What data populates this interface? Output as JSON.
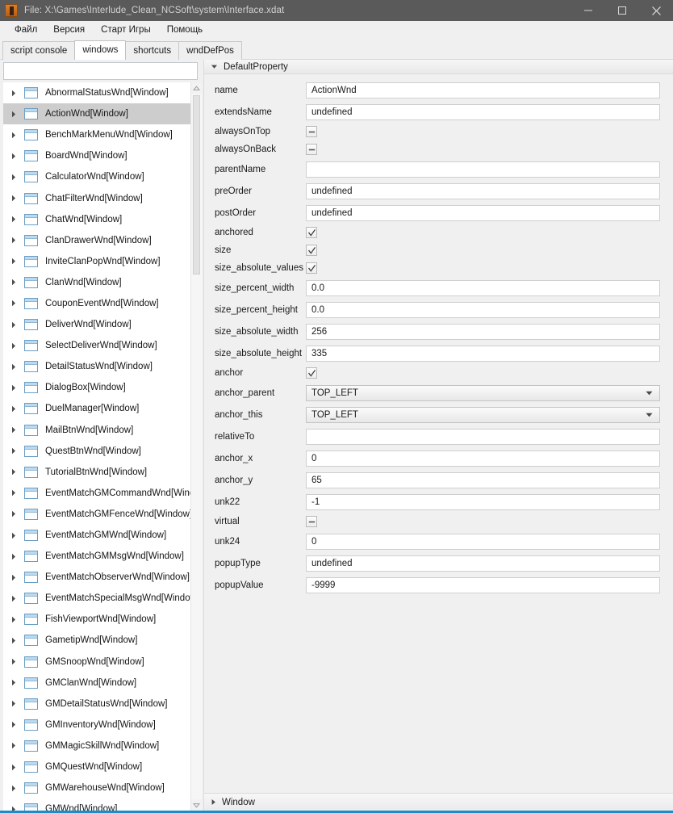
{
  "titlebar": {
    "title": "File: X:\\Games\\Interlude_Clean_NCSoft\\system\\Interface.xdat",
    "minimize_label": "—",
    "maximize_label": "☐",
    "close_label": "✕"
  },
  "menubar": {
    "items": [
      {
        "label": "Файл"
      },
      {
        "label": "Версия"
      },
      {
        "label": "Старт Игры"
      },
      {
        "label": "Помощь"
      }
    ]
  },
  "tabs": {
    "items": [
      {
        "label": "script console",
        "active": false
      },
      {
        "label": "windows",
        "active": true
      },
      {
        "label": "shortcuts",
        "active": false
      },
      {
        "label": "wndDefPos",
        "active": false
      }
    ]
  },
  "left_panel": {
    "filter": {
      "value": "",
      "placeholder": ""
    },
    "tree_items": [
      {
        "label": "AbnormalStatusWnd[Window]",
        "selected": false
      },
      {
        "label": "ActionWnd[Window]",
        "selected": true
      },
      {
        "label": "BenchMarkMenuWnd[Window]",
        "selected": false
      },
      {
        "label": "BoardWnd[Window]",
        "selected": false
      },
      {
        "label": "CalculatorWnd[Window]",
        "selected": false
      },
      {
        "label": "ChatFilterWnd[Window]",
        "selected": false
      },
      {
        "label": "ChatWnd[Window]",
        "selected": false
      },
      {
        "label": "ClanDrawerWnd[Window]",
        "selected": false
      },
      {
        "label": "InviteClanPopWnd[Window]",
        "selected": false
      },
      {
        "label": "ClanWnd[Window]",
        "selected": false
      },
      {
        "label": "CouponEventWnd[Window]",
        "selected": false
      },
      {
        "label": "DeliverWnd[Window]",
        "selected": false
      },
      {
        "label": "SelectDeliverWnd[Window]",
        "selected": false
      },
      {
        "label": "DetailStatusWnd[Window]",
        "selected": false
      },
      {
        "label": "DialogBox[Window]",
        "selected": false
      },
      {
        "label": "DuelManager[Window]",
        "selected": false
      },
      {
        "label": "MailBtnWnd[Window]",
        "selected": false
      },
      {
        "label": "QuestBtnWnd[Window]",
        "selected": false
      },
      {
        "label": "TutorialBtnWnd[Window]",
        "selected": false
      },
      {
        "label": "EventMatchGMCommandWnd[Window]",
        "selected": false
      },
      {
        "label": "EventMatchGMFenceWnd[Window]",
        "selected": false
      },
      {
        "label": "EventMatchGMWnd[Window]",
        "selected": false
      },
      {
        "label": "EventMatchGMMsgWnd[Window]",
        "selected": false
      },
      {
        "label": "EventMatchObserverWnd[Window]",
        "selected": false
      },
      {
        "label": "EventMatchSpecialMsgWnd[Window]",
        "selected": false
      },
      {
        "label": "FishViewportWnd[Window]",
        "selected": false
      },
      {
        "label": "GametipWnd[Window]",
        "selected": false
      },
      {
        "label": "GMSnoopWnd[Window]",
        "selected": false
      },
      {
        "label": "GMClanWnd[Window]",
        "selected": false
      },
      {
        "label": "GMDetailStatusWnd[Window]",
        "selected": false
      },
      {
        "label": "GMInventoryWnd[Window]",
        "selected": false
      },
      {
        "label": "GMMagicSkillWnd[Window]",
        "selected": false
      },
      {
        "label": "GMQuestWnd[Window]",
        "selected": false
      },
      {
        "label": "GMWarehouseWnd[Window]",
        "selected": false
      },
      {
        "label": "GMWnd[Window]",
        "selected": false
      }
    ]
  },
  "right_panel": {
    "section_title": "DefaultProperty",
    "bottom_section_title": "Window",
    "properties": [
      {
        "label": "name",
        "type": "text",
        "value": "ActionWnd"
      },
      {
        "label": "extendsName",
        "type": "text",
        "value": "undefined"
      },
      {
        "label": "alwaysOnTop",
        "type": "checkbox",
        "state": "indeterminate"
      },
      {
        "label": "alwaysOnBack",
        "type": "checkbox",
        "state": "indeterminate"
      },
      {
        "label": "parentName",
        "type": "text",
        "value": ""
      },
      {
        "label": "preOrder",
        "type": "text",
        "value": "undefined"
      },
      {
        "label": "postOrder",
        "type": "text",
        "value": "undefined"
      },
      {
        "label": "anchored",
        "type": "checkbox",
        "state": "checked"
      },
      {
        "label": "size",
        "type": "checkbox",
        "state": "checked"
      },
      {
        "label": "size_absolute_values",
        "type": "checkbox",
        "state": "checked"
      },
      {
        "label": "size_percent_width",
        "type": "text",
        "value": "0.0"
      },
      {
        "label": "size_percent_height",
        "type": "text",
        "value": "0.0"
      },
      {
        "label": "size_absolute_width",
        "type": "text",
        "value": "256"
      },
      {
        "label": "size_absolute_height",
        "type": "text",
        "value": "335"
      },
      {
        "label": "anchor",
        "type": "checkbox",
        "state": "checked"
      },
      {
        "label": "anchor_parent",
        "type": "combo",
        "value": "TOP_LEFT"
      },
      {
        "label": "anchor_this",
        "type": "combo",
        "value": "TOP_LEFT"
      },
      {
        "label": "relativeTo",
        "type": "text",
        "value": ""
      },
      {
        "label": "anchor_x",
        "type": "text",
        "value": "0"
      },
      {
        "label": "anchor_y",
        "type": "text",
        "value": "65"
      },
      {
        "label": "unk22",
        "type": "text",
        "value": "-1"
      },
      {
        "label": "virtual",
        "type": "checkbox",
        "state": "indeterminate"
      },
      {
        "label": "unk24",
        "type": "text",
        "value": "0"
      },
      {
        "label": "popupType",
        "type": "text",
        "value": "undefined"
      },
      {
        "label": "popupValue",
        "type": "text",
        "value": "-9999"
      }
    ]
  },
  "colors": {
    "titlebar_bg": "#5a5a5a",
    "selection": "#cdcdcd",
    "accent_blue": "#1e8bcd",
    "icon_orange": "#d9822b",
    "panel_bg": "#f0f0f0"
  }
}
